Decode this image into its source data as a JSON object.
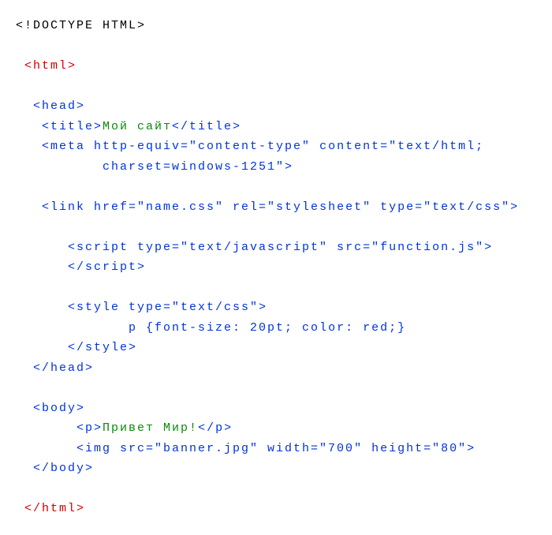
{
  "code": {
    "line1": "<!DOCTYPE HTML>",
    "html_open": "<html>",
    "head_open": "<head>",
    "title_open": "<title>",
    "title_text": "Мой сайт",
    "title_close": "</title>",
    "meta1": "<meta http-equiv=\"content-type\" content=\"text/html;",
    "meta2": "charset=windows-1251\">",
    "link": "<link href=\"name.css\" rel=\"stylesheet\" type=\"text/css\">",
    "script_open": "<script type=\"text/javascript\" src=\"function.js\">",
    "script_close": "</script>",
    "style_open": "<style type=\"text/css\">",
    "style_rule": "p {font-size: 20pt; color: red;}",
    "style_close": "</style>",
    "head_close": "</head>",
    "body_open": "<body>",
    "p_open": "<p>",
    "p_text": "Привет Мир!",
    "p_close": "</p>",
    "img": "<img src=\"banner.jpg\" width=\"700\" height=\"80\">",
    "body_close": "</body>",
    "html_close": "</html>"
  }
}
